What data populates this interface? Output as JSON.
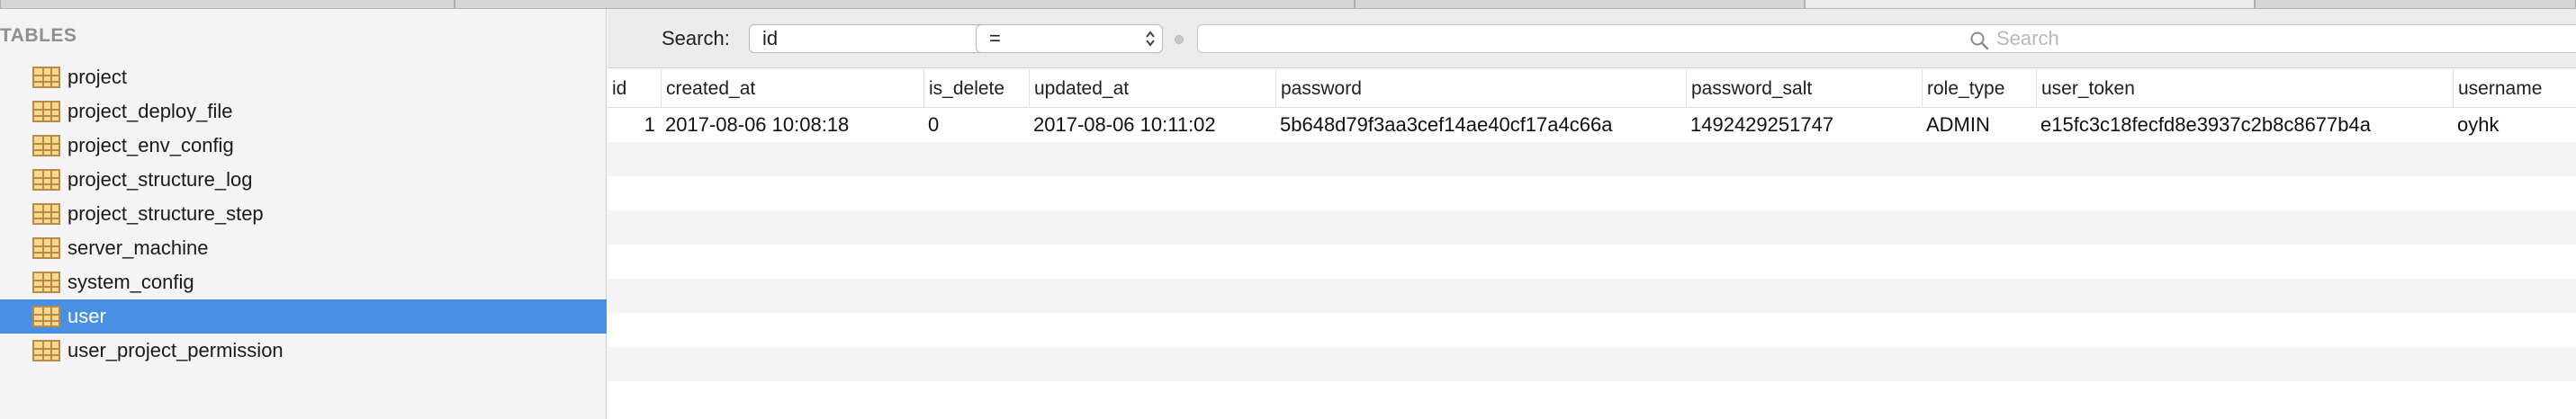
{
  "sidebar": {
    "header": "TABLES",
    "tables": [
      {
        "name": "project",
        "selected": false
      },
      {
        "name": "project_deploy_file",
        "selected": false
      },
      {
        "name": "project_env_config",
        "selected": false
      },
      {
        "name": "project_structure_log",
        "selected": false
      },
      {
        "name": "project_structure_step",
        "selected": false
      },
      {
        "name": "server_machine",
        "selected": false
      },
      {
        "name": "system_config",
        "selected": false
      },
      {
        "name": "user",
        "selected": true
      },
      {
        "name": "user_project_permission",
        "selected": false
      }
    ]
  },
  "filter": {
    "label": "Search:",
    "field": "id",
    "operator": "=",
    "search_placeholder": "Search",
    "search_value": ""
  },
  "grid": {
    "columns": [
      "id",
      "created_at",
      "is_delete",
      "updated_at",
      "password",
      "password_salt",
      "role_type",
      "user_token",
      "username"
    ],
    "rows": [
      [
        "1",
        "2017-08-06 10:08:18",
        "0",
        "2017-08-06 10:11:02",
        "5b648d79f3aa3cef14ae40cf17a4c66a",
        "1492429251747",
        "ADMIN",
        "e15fc3c18fecfd8e3937c2b8c8677b4a",
        "oyhk"
      ]
    ]
  },
  "colors": {
    "selection": "#4a90e2",
    "sidebar_bg": "#f4f4f4",
    "stripe": "#f4f4f4",
    "table_icon": "#f8da8b"
  }
}
